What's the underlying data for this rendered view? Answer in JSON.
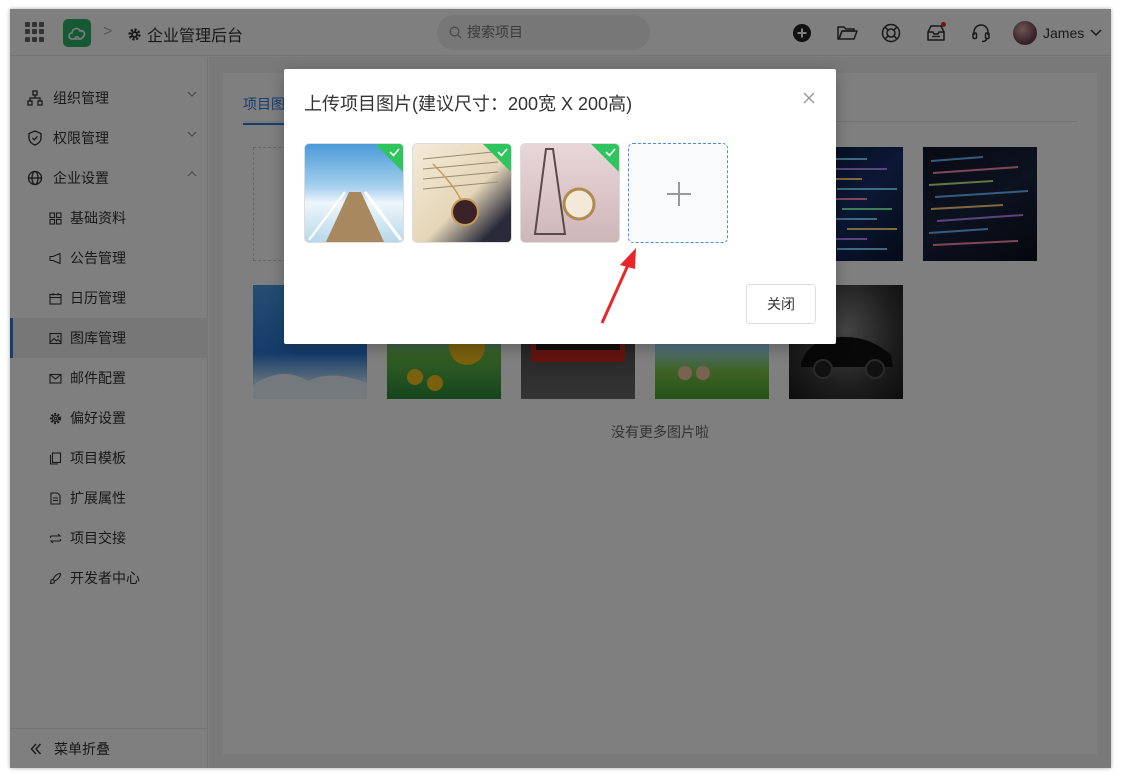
{
  "header": {
    "app_title": "企业管理后台",
    "search_placeholder": "搜索项目",
    "user_name": "James"
  },
  "sidebar": {
    "items": [
      {
        "label": "组织管理",
        "icon": "org-chart-icon",
        "level": 1,
        "expanded": false
      },
      {
        "label": "权限管理",
        "icon": "shield-icon",
        "level": 1,
        "expanded": false
      },
      {
        "label": "企业设置",
        "icon": "globe-icon",
        "level": 1,
        "expanded": true
      },
      {
        "label": "基础资料",
        "icon": "grid-icon",
        "level": 2
      },
      {
        "label": "公告管理",
        "icon": "megaphone-icon",
        "level": 2
      },
      {
        "label": "日历管理",
        "icon": "calendar-icon",
        "level": 2
      },
      {
        "label": "图库管理",
        "icon": "image-icon",
        "level": 2,
        "active": true
      },
      {
        "label": "邮件配置",
        "icon": "mail-icon",
        "level": 2
      },
      {
        "label": "偏好设置",
        "icon": "gear-icon",
        "level": 2
      },
      {
        "label": "项目模板",
        "icon": "copy-icon",
        "level": 2
      },
      {
        "label": "扩展属性",
        "icon": "document-icon",
        "level": 2
      },
      {
        "label": "项目交接",
        "icon": "swap-icon",
        "level": 2
      },
      {
        "label": "开发者中心",
        "icon": "rocket-icon",
        "level": 2
      }
    ],
    "collapse_label": "菜单折叠"
  },
  "main": {
    "tab_label": "项目图",
    "no_more_text": "没有更多图片啦"
  },
  "modal": {
    "title": "上传项目图片(建议尺寸：200宽 X 200高)",
    "close_button": "关闭",
    "uploaded_count": 3
  },
  "colors": {
    "accent": "#2a7ae2",
    "logo": "#2db36b",
    "check": "#2ec55e",
    "annotation_arrow": "#e8272a"
  }
}
